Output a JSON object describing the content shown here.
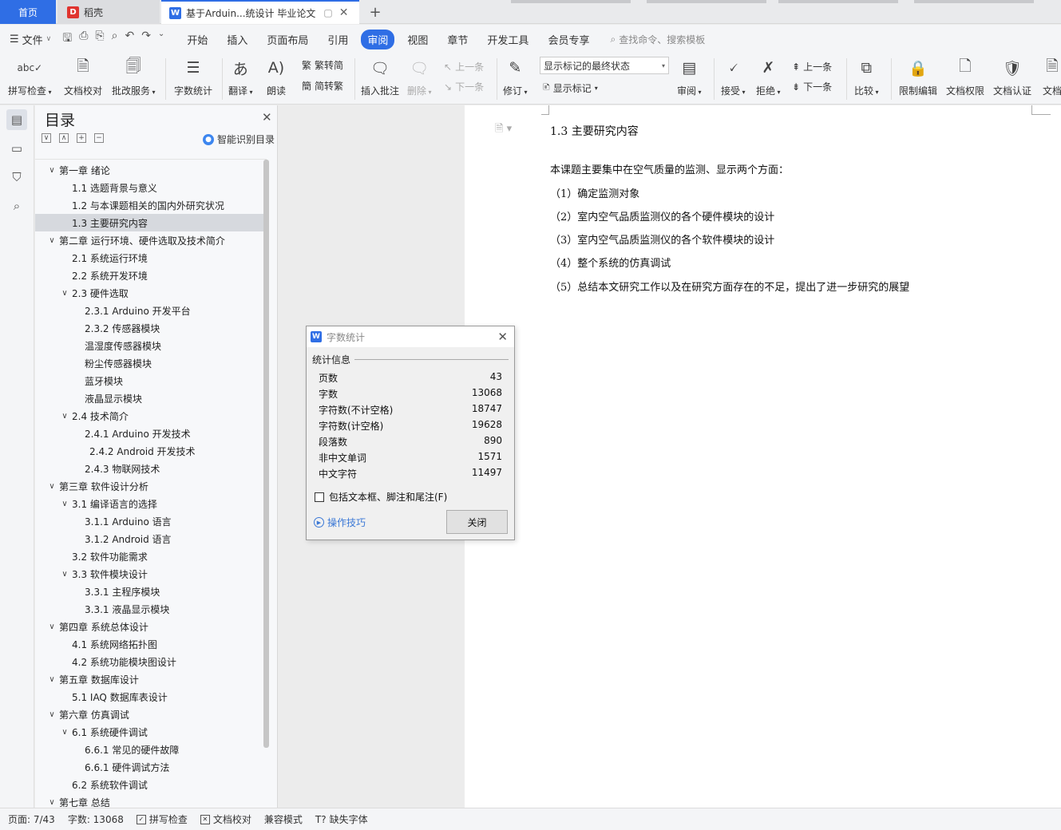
{
  "tabs": {
    "home": "首页",
    "daoke": "稻壳",
    "doc": "基于Arduin...统设计 毕业论文",
    "add": "+"
  },
  "menu": {
    "file": "文件",
    "tabs": [
      "开始",
      "插入",
      "页面布局",
      "引用",
      "审阅",
      "视图",
      "章节",
      "开发工具",
      "会员专享"
    ],
    "active_tab": "审阅",
    "search_placeholder": "查找命令、搜索模板"
  },
  "ribbon": {
    "spell_check": "拼写检查",
    "doc_proof": "文档校对",
    "revise_service": "批改服务",
    "word_count": "字数统计",
    "translate": "翻译",
    "read_aloud": "朗读",
    "to_traditional": "繁转简",
    "to_simplified": "简转繁",
    "insert_comment": "插入批注",
    "delete": "删除",
    "prev_comment": "上一条",
    "next_comment": "下一条",
    "track_changes": "修订",
    "markup_state": "显示标记的最终状态",
    "show_markup": "显示标记",
    "review": "审阅",
    "accept": "接受",
    "reject": "拒绝",
    "prev_change": "上一条",
    "next_change": "下一条",
    "compare": "比较",
    "restrict_edit": "限制编辑",
    "doc_permission": "文档权限",
    "doc_certify": "文档认证",
    "doc_more": "文档"
  },
  "toc": {
    "title": "目录",
    "smart": "智能识别目录",
    "items": [
      {
        "text": "第一章  绪论",
        "level": 0,
        "chev": "∨"
      },
      {
        "text": "1.1  选题背景与意义",
        "level": 1
      },
      {
        "text": "1.2  与本课题相关的国内外研究状况",
        "level": 1
      },
      {
        "text": "1.3  主要研究内容",
        "level": 1,
        "selected": true
      },
      {
        "text": "第二章  运行环境、硬件选取及技术简介",
        "level": 0,
        "chev": "∨"
      },
      {
        "text": "2.1  系统运行环境",
        "level": 1
      },
      {
        "text": "2.2  系统开发环境",
        "level": 1
      },
      {
        "text": "2.3  硬件选取",
        "level": 1,
        "chev": "∨"
      },
      {
        "text": "2.3.1 Arduino 开发平台",
        "level": 2
      },
      {
        "text": "2.3.2  传感器模块",
        "level": 2
      },
      {
        "text": "温湿度传感器模块",
        "level": 2
      },
      {
        "text": "粉尘传感器模块",
        "level": 2
      },
      {
        "text": "蓝牙模块",
        "level": 2
      },
      {
        "text": "液晶显示模块",
        "level": 2
      },
      {
        "text": "2.4  技术简介",
        "level": 1,
        "chev": "∨"
      },
      {
        "text": "2.4.1 Arduino 开发技术",
        "level": 2
      },
      {
        "text": "2.4.2 Android 开发技术",
        "level": 3
      },
      {
        "text": "2.4.3  物联网技术",
        "level": 2
      },
      {
        "text": "第三章  软件设计分析",
        "level": 0,
        "chev": "∨"
      },
      {
        "text": "3.1  编译语言的选择",
        "level": 1,
        "chev": "∨"
      },
      {
        "text": "3.1.1 Arduino 语言",
        "level": 2
      },
      {
        "text": "3.1.2 Android 语言",
        "level": 2
      },
      {
        "text": "3.2  软件功能需求",
        "level": 1
      },
      {
        "text": "3.3  软件模块设计",
        "level": 1,
        "chev": "∨"
      },
      {
        "text": "3.3.1  主程序模块",
        "level": 2
      },
      {
        "text": "3.3.1  液晶显示模块",
        "level": 2
      },
      {
        "text": "第四章  系统总体设计",
        "level": 0,
        "chev": "∨"
      },
      {
        "text": "4.1  系统网络拓扑图",
        "level": 1
      },
      {
        "text": "4.2  系统功能模块图设计",
        "level": 1
      },
      {
        "text": "第五章  数据库设计",
        "level": 0,
        "chev": "∨"
      },
      {
        "text": "5.1 IAQ 数据库表设计",
        "level": 1
      },
      {
        "text": "第六章  仿真调试",
        "level": 0,
        "chev": "∨"
      },
      {
        "text": "6.1 系统硬件调试",
        "level": 1,
        "chev": "∨"
      },
      {
        "text": "6.6.1  常见的硬件故障",
        "level": 2
      },
      {
        "text": "6.6.1  硬件调试方法",
        "level": 2
      },
      {
        "text": "6.2 系统软件调试",
        "level": 1
      },
      {
        "text": "第七章  总结",
        "level": 0,
        "chev": "∨"
      }
    ]
  },
  "document": {
    "heading": "1.3  主要研究内容",
    "intro": "本课题主要集中在空气质量的监测、显示两个方面：",
    "lines": [
      "（1）确定监测对象",
      "（2）室内空气品质监测仪的各个硬件模块的设计",
      "（3）室内空气品质监测仪的各个软件模块的设计",
      "（4）整个系统的仿真调试",
      "（5）总结本文研究工作以及在研究方面存在的不足，提出了进一步研究的展望"
    ]
  },
  "dialog": {
    "title": "字数统计",
    "section": "统计信息",
    "rows": [
      {
        "label": "页数",
        "value": "43"
      },
      {
        "label": "字数",
        "value": "13068"
      },
      {
        "label": "字符数(不计空格)",
        "value": "18747"
      },
      {
        "label": "字符数(计空格)",
        "value": "19628"
      },
      {
        "label": "段落数",
        "value": "890"
      },
      {
        "label": "非中文单词",
        "value": "1571"
      },
      {
        "label": "中文字符",
        "value": "11497"
      }
    ],
    "checkbox": "包括文本框、脚注和尾注(F)",
    "checkbox_checked": false,
    "tips": "操作技巧",
    "close": "关闭"
  },
  "status": {
    "page": "页面: 7/43",
    "words": "字数: 13068",
    "spell": "拼写检查",
    "proof": "文档校对",
    "compat": "兼容模式",
    "missing_font": "缺失字体"
  },
  "colors": {
    "accent": "#2f6ee5",
    "selected_row": "#d6d9de",
    "link": "#3b78d6"
  }
}
